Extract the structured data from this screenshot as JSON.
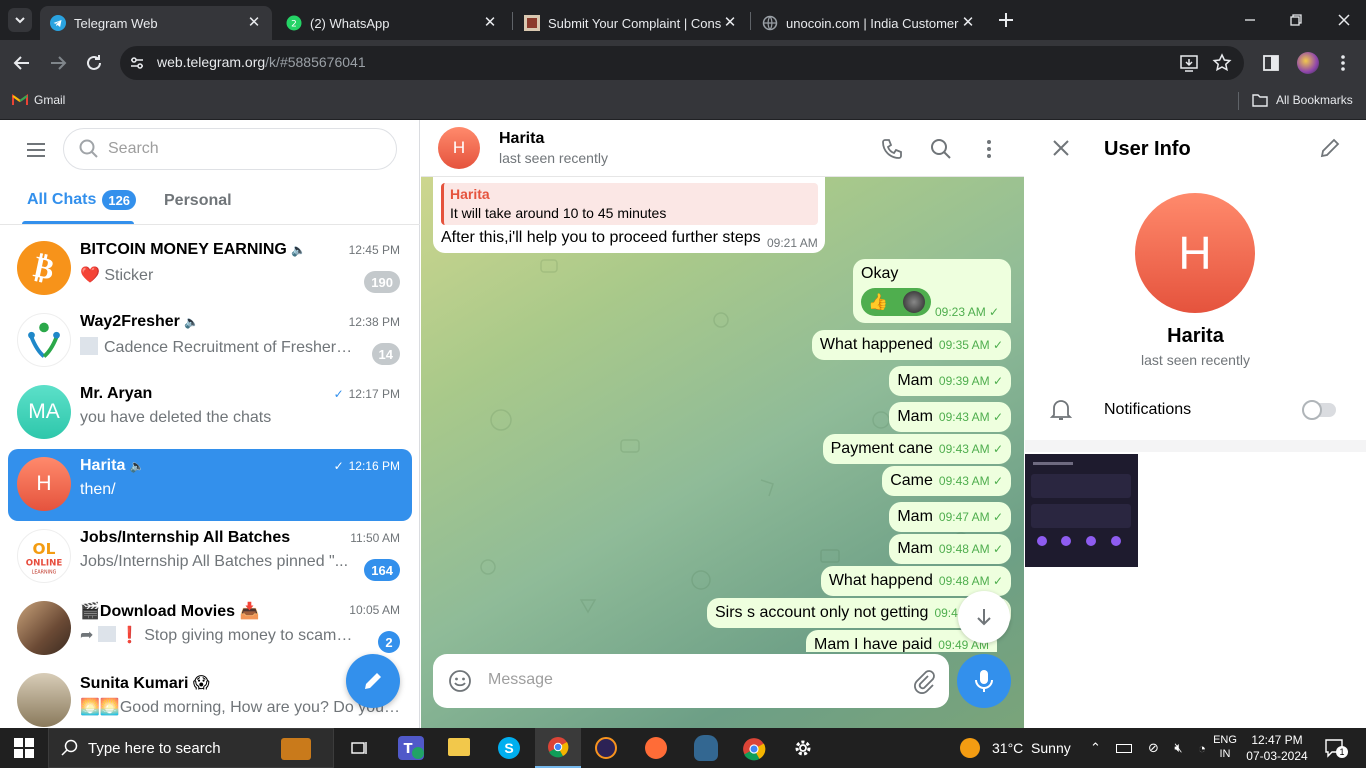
{
  "browser": {
    "tabs": [
      {
        "title": "Telegram Web",
        "active": true
      },
      {
        "title": "(2) WhatsApp",
        "active": false
      },
      {
        "title": "Submit Your Complaint | Consu",
        "active": false
      },
      {
        "title": "unocoin.com | India Customer C",
        "active": false
      }
    ],
    "url_host": "web.telegram.org",
    "url_path": "/k/#5885676041",
    "bookmarks": {
      "gmail": "Gmail",
      "all": "All Bookmarks"
    }
  },
  "sidebar": {
    "search_placeholder": "Search",
    "tabs": [
      {
        "label": "All Chats",
        "count": "126",
        "active": true
      },
      {
        "label": "Personal",
        "active": false
      }
    ],
    "chats": [
      {
        "name": "BITCOIN MONEY EARNING",
        "time": "12:45 PM",
        "preview": "Sticker",
        "emoji": "❤️",
        "badge": "190",
        "muted": true,
        "avatar_color": "#f7931a"
      },
      {
        "name": "Way2Fresher",
        "time": "12:38 PM",
        "preview": "Cadence Recruitment of Fresher S...",
        "badge": "14",
        "muted": true
      },
      {
        "name": "Mr. Aryan",
        "time": "12:17 PM",
        "preview": "you have deleted the chats",
        "initials": "MA",
        "avatar_color": "#3ad5b9"
      },
      {
        "name": "Harita",
        "time": "12:16 PM",
        "preview": "then/",
        "initials": "H",
        "active": true,
        "muted": true,
        "avatar_color": "#ee5b4a"
      },
      {
        "name": "Jobs/Internship All Batches",
        "time": "11:50 AM",
        "preview": "Jobs/Internship All Batches pinned \"...",
        "badge": "164",
        "badge_color": "blue"
      },
      {
        "name": "🎬Download Movies 📥",
        "time": "10:05 AM",
        "preview": "❗ Stop giving money to scamme...",
        "badge": "2",
        "badge_color": "blue"
      },
      {
        "name": "Sunita Kumari 😱",
        "time": "",
        "preview": "🌅🌅Good morning, How are you? Do you h..."
      }
    ]
  },
  "chat": {
    "name": "Harita",
    "status": "last seen recently",
    "initials": "H",
    "reply": {
      "author": "Harita",
      "text": "It will take around 10 to 45 minutes"
    },
    "messages": [
      {
        "text": "After this,i'll help you to proceed further steps",
        "time": "09:21 AM",
        "dir": "in"
      },
      {
        "text": "Okay",
        "time": "09:23 AM",
        "dir": "out",
        "reaction": "👍"
      },
      {
        "text": "What happened",
        "time": "09:35 AM",
        "dir": "out"
      },
      {
        "text": "Mam",
        "time": "09:39 AM",
        "dir": "out"
      },
      {
        "text": "Mam",
        "time": "09:43 AM",
        "dir": "out"
      },
      {
        "text": "Payment cane",
        "time": "09:43 AM",
        "dir": "out"
      },
      {
        "text": "Came",
        "time": "09:43 AM",
        "dir": "out"
      },
      {
        "text": "Mam",
        "time": "09:47 AM",
        "dir": "out"
      },
      {
        "text": "Mam",
        "time": "09:48 AM",
        "dir": "out"
      },
      {
        "text": "What happend",
        "time": "09:48 AM",
        "dir": "out"
      },
      {
        "text": "Sirs s account only not getting",
        "time": "09:4",
        "dir": "out"
      },
      {
        "text": "Mam I have paid",
        "time": "09:49 AM",
        "dir": "out"
      }
    ],
    "composer_placeholder": "Message"
  },
  "info": {
    "title": "User Info",
    "initials": "H",
    "name": "Harita",
    "status": "last seen recently",
    "notifications_label": "Notifications",
    "notifications_on": false
  },
  "taskbar": {
    "search_placeholder": "Type here to search",
    "weather": "31°C  Sunny",
    "lang_top": "ENG",
    "lang_bottom": "IN",
    "time": "12:47 PM",
    "date": "07-03-2024",
    "notif_count": "1"
  },
  "colors": {
    "accent": "#3390ec",
    "out_bubble": "#eeffde",
    "check": "#4fae4e"
  }
}
